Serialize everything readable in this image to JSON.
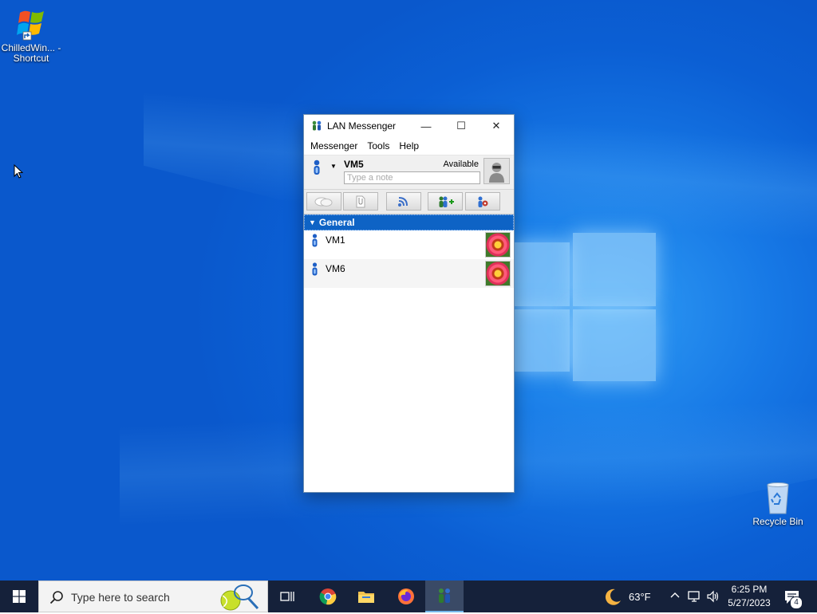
{
  "desktop": {
    "icons": [
      {
        "label": "ChilledWin... - Shortcut"
      },
      {
        "label": "Recycle Bin"
      }
    ]
  },
  "window": {
    "title": "LAN Messenger",
    "controls": {
      "minimize": "—",
      "maximize": "☐",
      "close": "✕"
    },
    "menu": [
      "Messenger",
      "Tools",
      "Help"
    ],
    "user": {
      "name": "VM5",
      "status": "Available",
      "note_placeholder": "Type a note",
      "note_value": ""
    },
    "group": {
      "name": "General"
    },
    "contacts": [
      {
        "name": "VM1"
      },
      {
        "name": "VM6"
      }
    ]
  },
  "taskbar": {
    "search_placeholder": "Type here to search",
    "weather": "63°F",
    "time": "6:25 PM",
    "date": "5/27/2023",
    "notifications": "4"
  }
}
